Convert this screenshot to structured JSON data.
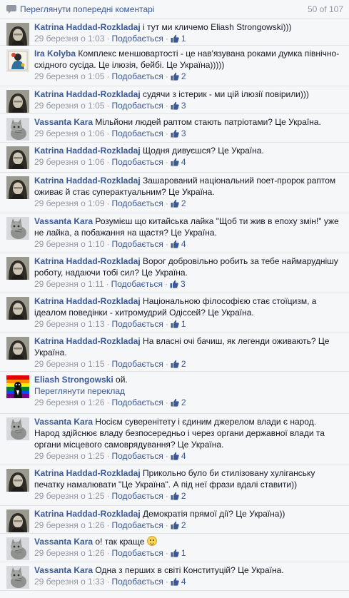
{
  "pager": {
    "more_label": "Переглянути попередні коментарі",
    "count": "50 of 107"
  },
  "labels": {
    "like": "Подобається",
    "see_translation": "Переглянути переклад",
    "dot": "·"
  },
  "comments": [
    {
      "author": "Katrina Haddad-Rozkladaj",
      "avatar": "woman",
      "text": "і тут ми кличемо Eliash Strongowski)))",
      "time": "29 березня о 1:03",
      "likes": "1"
    },
    {
      "author": "Ira Kolyba",
      "avatar": "stylized",
      "text": "Комплекс меншовартості - це нав'язувана роками думка північно-східного сусіда. Це ілюзія, бейбі. Це Україна)))))",
      "time": "29 березня о 1:05",
      "likes": "2"
    },
    {
      "author": "Katrina Haddad-Rozkladaj",
      "avatar": "woman",
      "text": "судячи з істерик - ми цій ілюзії повірили)))",
      "time": "29 березня о 1:05",
      "likes": "3"
    },
    {
      "author": "Vassanta Kara",
      "avatar": "cat",
      "text": "Мільйони людей раптом стають патріотами? Це Україна.",
      "time": "29 березня о 1:06",
      "likes": "3"
    },
    {
      "author": "Katrina Haddad-Rozkladaj",
      "avatar": "woman",
      "text": "Щодня дивуєшся? Це Україна.",
      "time": "29 березня о 1:06",
      "likes": "4"
    },
    {
      "author": "Katrina Haddad-Rozkladaj",
      "avatar": "woman",
      "text": "Зашарований національний поет-пророк раптом оживає й стає суперактуальним? Це Україна.",
      "time": "29 березня о 1:09",
      "likes": "2"
    },
    {
      "author": "Vassanta Kara",
      "avatar": "cat",
      "text": "Розумієш що китайська лайка \"Щоб ти жив в епоху змін!\" уже не лайка, а побажання на щастя? Це Україна.",
      "time": "29 березня о 1:10",
      "likes": "4"
    },
    {
      "author": "Katrina Haddad-Rozkladaj",
      "avatar": "woman",
      "text": "Ворог добровільно робить за тебе наймаруднішу роботу, надаючи тобі сил? Це Україна.",
      "time": "29 березня о 1:11",
      "likes": "3"
    },
    {
      "author": "Katrina Haddad-Rozkladaj",
      "avatar": "woman",
      "text": "Національною філософією стає стоїцизм, а ідеалом поведінки - хитромудрий Одіссей? Це Україна.",
      "time": "29 березня о 1:13",
      "likes": "1"
    },
    {
      "author": "Katrina Haddad-Rozkladaj",
      "avatar": "woman",
      "text": "На власні очі бачиш, як легенди оживають? Це Україна.",
      "time": "29 березня о 1:15",
      "likes": "2"
    },
    {
      "author": "Eliash Strongowski",
      "avatar": "rainbow",
      "text": "ой.",
      "time": "29 березня о 1:26",
      "likes": "2",
      "translation": true
    },
    {
      "author": "Vassanta Kara",
      "avatar": "cat",
      "text": "Носієм суверенітету і єдиним джерелом влади є народ. Народ здійснює владу безпосередньо і через органи державної влади та органи місцевого самоврядування? Це Україна.",
      "time": "29 березня о 1:25",
      "likes": "4"
    },
    {
      "author": "Katrina Haddad-Rozkladaj",
      "avatar": "woman",
      "text": "Прикольно було би стилізовану хуліганську печатку намалювати \"Це Україна\". А під неї фрази вдалі ставити))",
      "time": "29 березня о 1:25",
      "likes": "2"
    },
    {
      "author": "Katrina Haddad-Rozkladaj",
      "avatar": "woman",
      "text": "Демократія прямої дії? Це Україна))",
      "time": "29 березня о 1:26",
      "likes": "2"
    },
    {
      "author": "Vassanta Kara",
      "avatar": "cat",
      "text": "о! так краще",
      "time": "29 березня о 1:26",
      "likes": "1",
      "smiley": true
    },
    {
      "author": "Vassanta Kara",
      "avatar": "cat",
      "text": "Одна з перших в світі Конституцій? Це Україна.",
      "time": "29 березня о 1:33",
      "likes": "4"
    }
  ],
  "colors": {
    "link": "#3b5998",
    "meta": "#9197a3",
    "background": "#f6f7f8"
  }
}
